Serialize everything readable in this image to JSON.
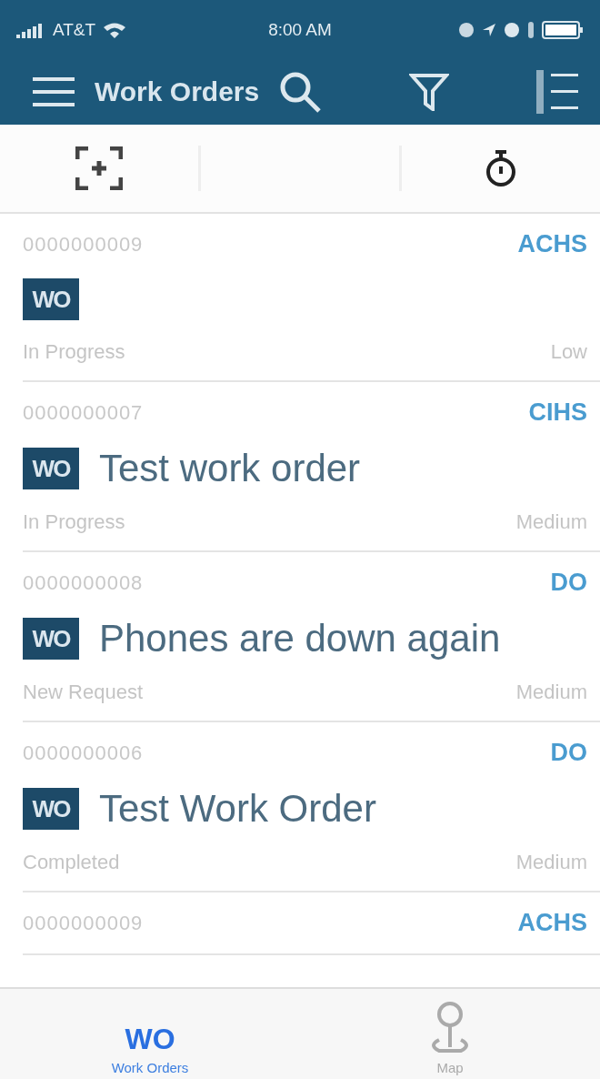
{
  "status_bar": {
    "carrier": "AT&T",
    "time": "8:00 AM"
  },
  "header": {
    "title": "Work Orders"
  },
  "work_orders": [
    {
      "number": "0000000009",
      "code": "ACHS",
      "badge": "WO",
      "status": "In Progress",
      "priority": "Low"
    },
    {
      "number": "0000000007",
      "code": "CIHS",
      "badge": "WO",
      "title": "Test work order",
      "status": "In Progress",
      "priority": "Medium"
    },
    {
      "number": "0000000008",
      "code": "DO",
      "badge": "WO",
      "title": "Phones are down again",
      "status": "New Request",
      "priority": "Medium"
    },
    {
      "number": "0000000006",
      "code": "DO",
      "badge": "WO",
      "title": "Test Work Order",
      "status": "Completed",
      "priority": "Medium"
    },
    {
      "number": "0000000009",
      "code": "ACHS"
    }
  ],
  "tab_bar": [
    {
      "kind": "text-icon",
      "icon_text": "WO",
      "label": "Work Orders",
      "selected": true
    },
    {
      "kind": "map",
      "label": "Map",
      "selected": false
    }
  ]
}
